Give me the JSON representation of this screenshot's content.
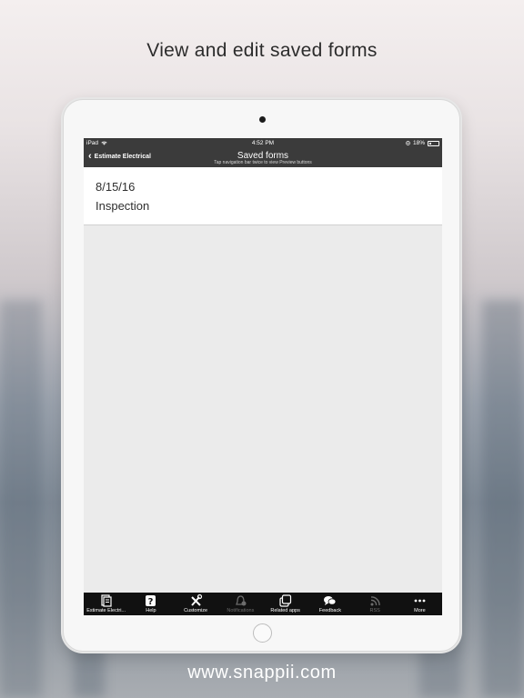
{
  "promo": {
    "headline": "View and edit saved forms",
    "footer_url": "www.snappii.com"
  },
  "status_bar": {
    "device": "iPad",
    "time": "4:52 PM",
    "battery": "18%"
  },
  "nav": {
    "back_label": "Estimate Electrical",
    "title": "Saved forms",
    "subtitle": "Tap navigation bar twice to view Preview buttons"
  },
  "saved_forms": [
    {
      "date": "8/15/16",
      "name": "Inspection"
    }
  ],
  "tab_bar": {
    "items": [
      {
        "label": "Estimate Electri...",
        "icon": "forms-icon",
        "enabled": true
      },
      {
        "label": "Help",
        "icon": "help-icon",
        "enabled": true
      },
      {
        "label": "Customize",
        "icon": "tools-icon",
        "enabled": true
      },
      {
        "label": "Notifications",
        "icon": "notifications-icon",
        "enabled": false
      },
      {
        "label": "Related apps",
        "icon": "related-apps-icon",
        "enabled": true
      },
      {
        "label": "Feedback",
        "icon": "feedback-icon",
        "enabled": true
      },
      {
        "label": "RSS",
        "icon": "rss-icon",
        "enabled": false
      },
      {
        "label": "More",
        "icon": "more-icon",
        "enabled": true
      }
    ]
  },
  "colors": {
    "nav_bar": "#3b3b3b",
    "tab_bar": "#111111",
    "screen_bg": "#ebebeb"
  }
}
